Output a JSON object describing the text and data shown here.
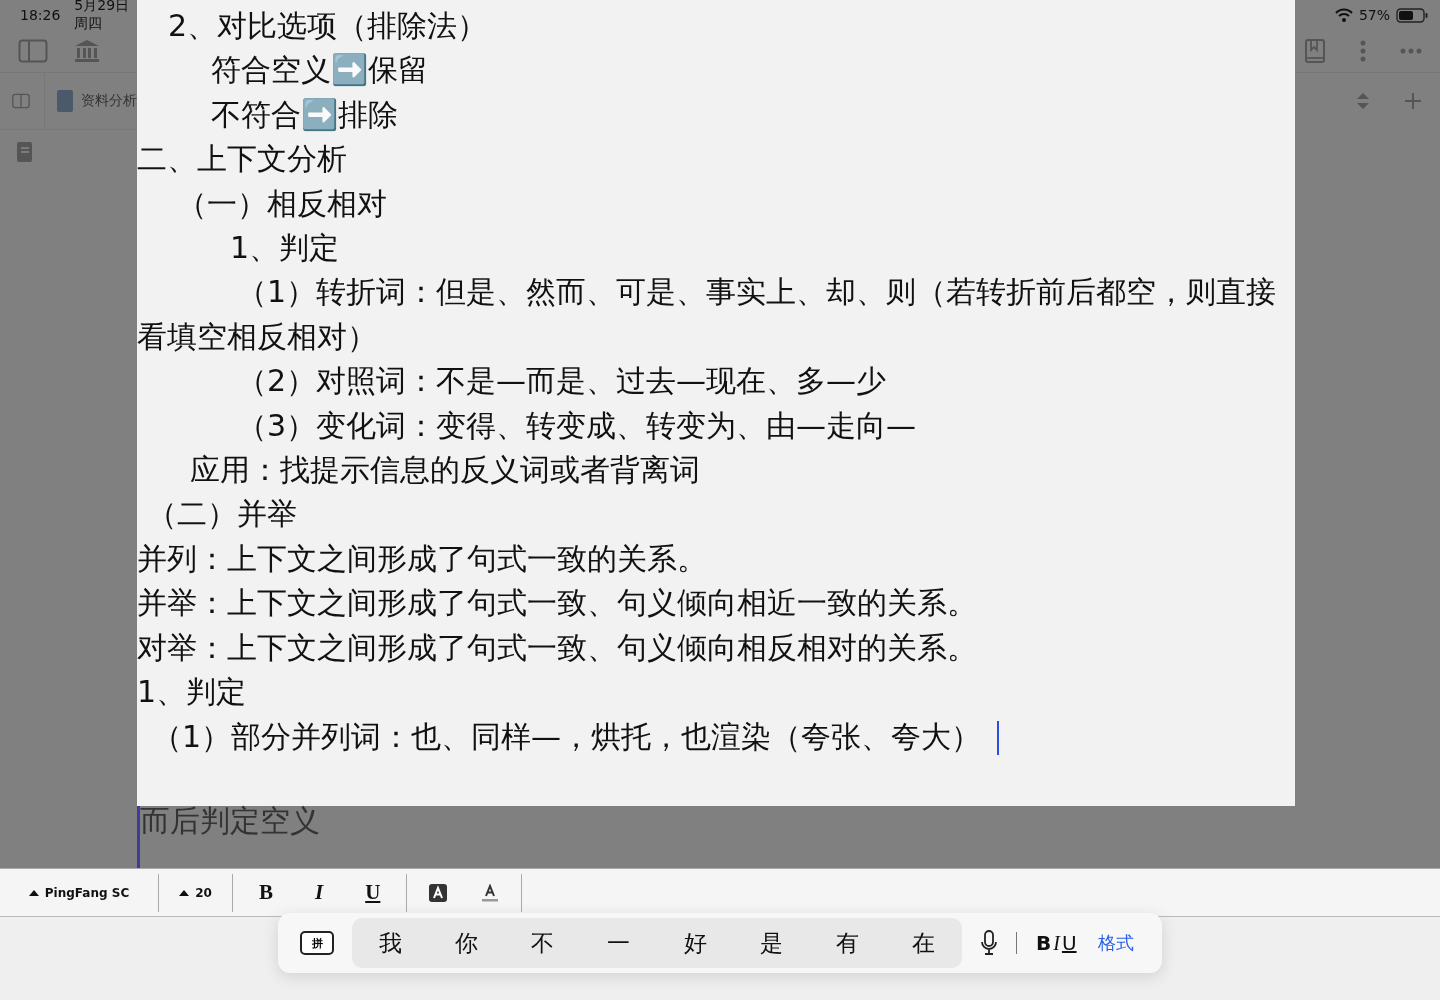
{
  "status_bar": {
    "time": "18:26",
    "date": "5月29日周四",
    "battery": "57%"
  },
  "tab": {
    "label": "资料分析"
  },
  "panel": {
    "lines": [
      {
        "kind": "point",
        "text": "2、对比选项（排除法）",
        "cursor": false
      },
      {
        "kind": "detail",
        "text": "符合空义➡️保留",
        "cursor": false
      },
      {
        "kind": "detail",
        "text": "不符合➡️排除",
        "cursor": false
      },
      {
        "kind": "section",
        "text": "二、上下文分析",
        "cursor": false
      },
      {
        "kind": "subsection",
        "text": "（一）相反相对",
        "cursor": false
      },
      {
        "kind": "step",
        "text": "1、判定",
        "cursor": false
      },
      {
        "kind": "example",
        "text": "（1）转折词：但是、然而、可是、事实上、却、则（若转折前后都空，则直接看填空相反相对）",
        "cursor": false
      },
      {
        "kind": "example",
        "text": "（2）对照词：不是—而是、过去—现在、多—少",
        "cursor": false
      },
      {
        "kind": "example",
        "text": "（3）变化词：变得、转变成、转变为、由—走向—",
        "cursor": false
      },
      {
        "kind": "note",
        "text": "应用：找提示信息的反义词或者背离词",
        "cursor": false
      },
      {
        "kind": "subsection-alt",
        "text": "（二）并举",
        "cursor": false
      },
      {
        "kind": "section",
        "text": "并列：上下文之间形成了句式一致的关系。",
        "cursor": false
      },
      {
        "kind": "section",
        "text": "并举：上下文之间形成了句式一致、句义倾向相近一致的关系。",
        "cursor": false
      },
      {
        "kind": "section",
        "text": "对举：上下文之间形成了句式一致、句义倾向相反相对的关系。",
        "cursor": false
      },
      {
        "kind": "section",
        "text": "1、判定",
        "cursor": false
      },
      {
        "kind": "list",
        "text": "（1）部分并列词：也、同样—，烘托，也渲染（夸张、夸大）",
        "cursor": true
      }
    ]
  },
  "document": {
    "text": "而后判定空义"
  },
  "format_bar": {
    "font": "PingFang SC",
    "size": "20",
    "bold": "B",
    "italic": "I",
    "underline": "U"
  },
  "candidate_bar": {
    "input_mode": "拼",
    "candidates": [
      "我",
      "你",
      "不",
      "一",
      "好",
      "是",
      "有",
      "在"
    ],
    "bold": "B",
    "italic": "I",
    "underline": "U",
    "format": "格式"
  }
}
